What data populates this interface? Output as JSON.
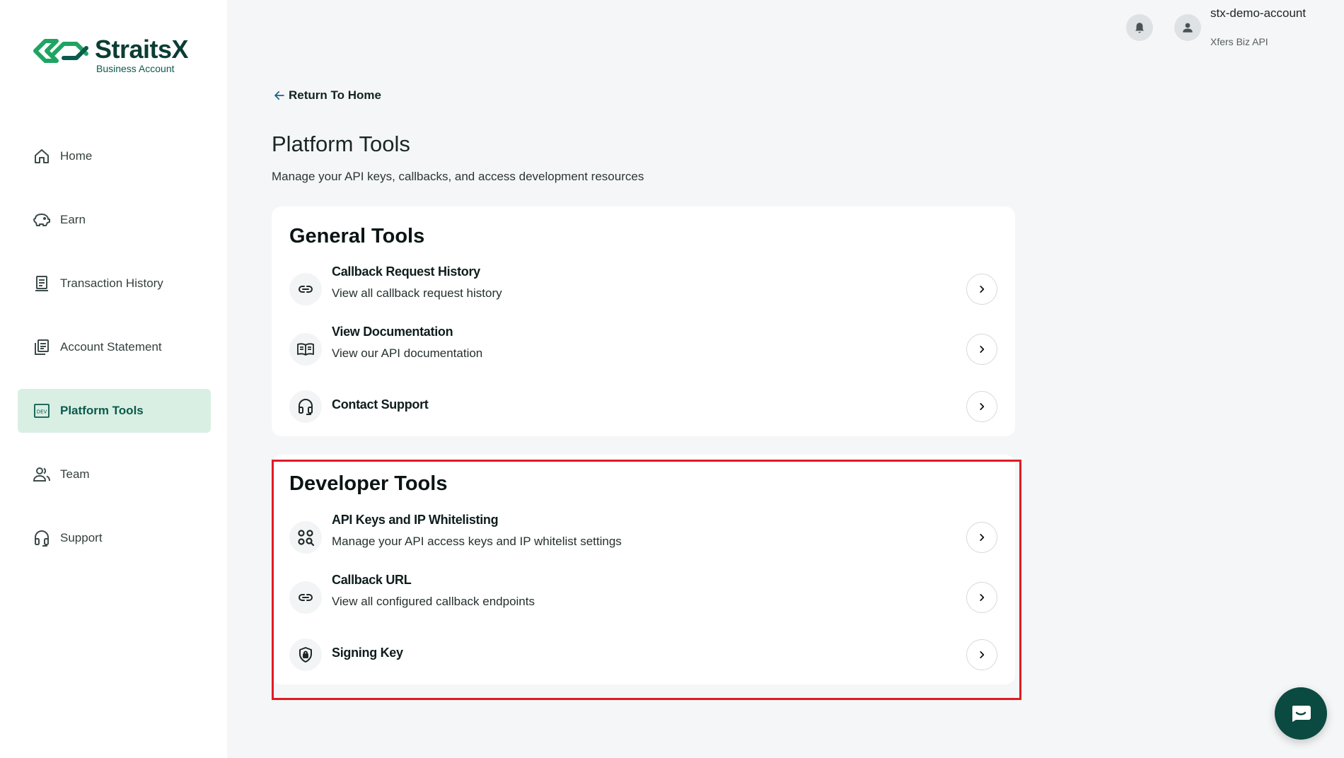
{
  "brand": {
    "name": "StraitsX",
    "sub": "Business Account",
    "color": "#0b3d34",
    "accent": "#1fa463"
  },
  "sidebar": {
    "items": [
      {
        "label": "Home",
        "icon": "home-icon"
      },
      {
        "label": "Earn",
        "icon": "piggy-bank-icon"
      },
      {
        "label": "Transaction History",
        "icon": "receipt-icon"
      },
      {
        "label": "Account Statement",
        "icon": "document-stack-icon"
      },
      {
        "label": "Platform Tools",
        "icon": "dev-icon",
        "active": true
      },
      {
        "label": "Team",
        "icon": "team-icon"
      },
      {
        "label": "Support",
        "icon": "headset-icon"
      }
    ]
  },
  "header": {
    "account_name": "stx-demo-account",
    "account_type": "Xfers Biz API"
  },
  "main": {
    "back_label": "Return To Home",
    "title": "Platform Tools",
    "subtitle": "Manage your API keys, callbacks, and access development resources",
    "general": {
      "heading": "General Tools",
      "items": [
        {
          "title": "Callback Request History",
          "desc": "View all callback request history",
          "icon": "link-icon"
        },
        {
          "title": "View Documentation",
          "desc": "View our API documentation",
          "icon": "book-icon"
        },
        {
          "title": "Contact Support",
          "desc": "",
          "icon": "headset-icon"
        }
      ]
    },
    "developer": {
      "heading": "Developer Tools",
      "items": [
        {
          "title": "API Keys and IP Whitelisting",
          "desc": "Manage your API access keys and IP whitelist settings",
          "icon": "key-search-icon"
        },
        {
          "title": "Callback URL",
          "desc": "View all configured callback endpoints",
          "icon": "link-icon"
        },
        {
          "title": "Signing Key",
          "desc": "",
          "icon": "shield-lock-icon"
        }
      ]
    }
  },
  "highlight_color": "#e01b24"
}
